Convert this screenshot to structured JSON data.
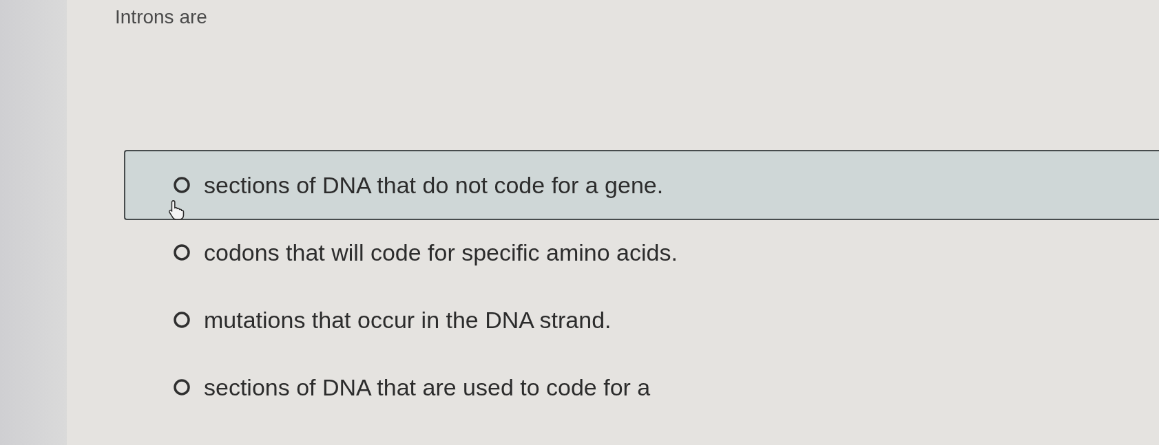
{
  "question": {
    "text": "Introns are"
  },
  "options": [
    {
      "text": "sections of DNA that do not code for a gene.",
      "selected": false,
      "hovered": true
    },
    {
      "text": "codons that will code for specific amino acids.",
      "selected": false,
      "hovered": false
    },
    {
      "text": "mutations that occur in the DNA strand.",
      "selected": false,
      "hovered": false
    },
    {
      "text": "sections of DNA that are used to code for a",
      "selected": false,
      "hovered": false
    }
  ]
}
